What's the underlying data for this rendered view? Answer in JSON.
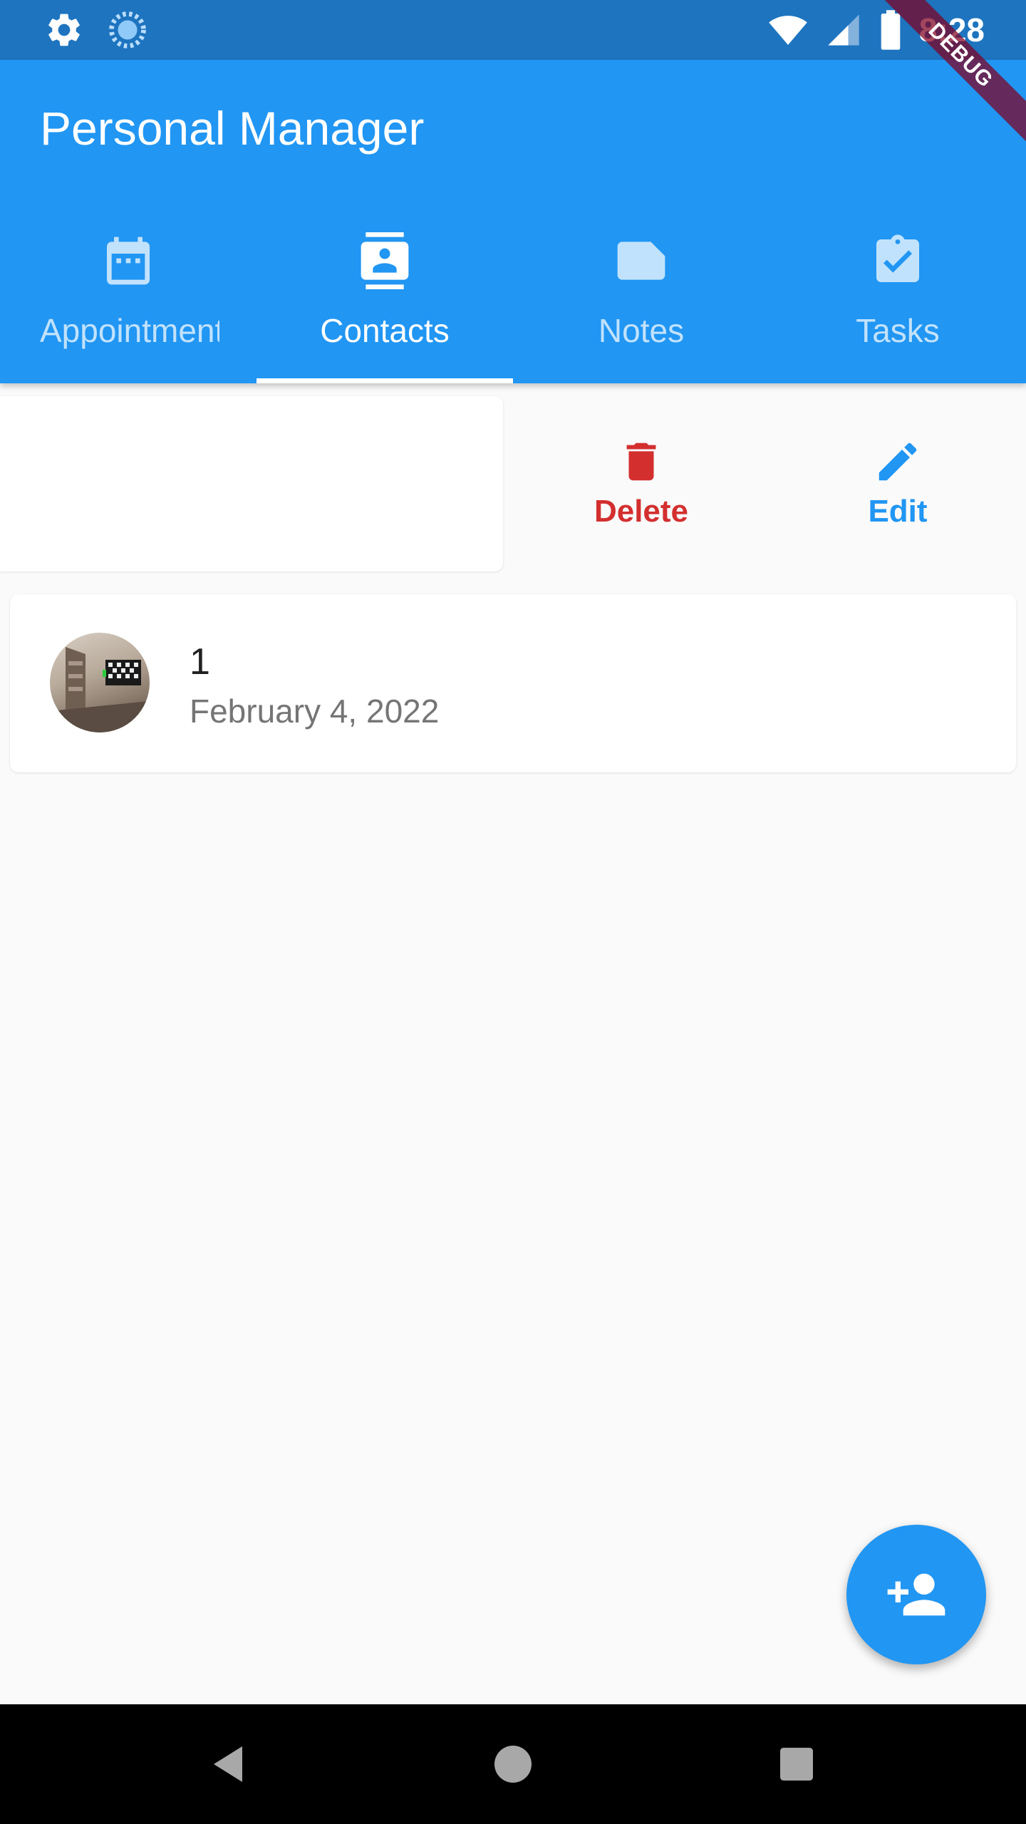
{
  "status_bar": {
    "time": "8:28",
    "icons": [
      "gear-icon",
      "sync-icon",
      "wifi-icon",
      "signal-icon",
      "battery-icon"
    ]
  },
  "app_bar": {
    "title": "Personal Manager"
  },
  "tabs": [
    {
      "label": "Appointments",
      "icon": "calendar-icon",
      "active": false
    },
    {
      "label": "Contacts",
      "icon": "contacts-icon",
      "active": true
    },
    {
      "label": "Notes",
      "icon": "note-icon",
      "active": false
    },
    {
      "label": "Tasks",
      "icon": "task-check-icon",
      "active": false
    }
  ],
  "slide_actions": {
    "delete_label": "Delete",
    "edit_label": "Edit"
  },
  "contacts": [
    {
      "name": "1",
      "date": "February 4, 2022",
      "avatar": "photo-avatar"
    }
  ],
  "fab": {
    "icon": "add-person-icon"
  },
  "debug_banner": {
    "label": "DEBUG"
  },
  "colors": {
    "status_bar": "#1e74bf",
    "primary": "#2196f3",
    "delete": "#d32f2f",
    "background": "#fafafa"
  }
}
